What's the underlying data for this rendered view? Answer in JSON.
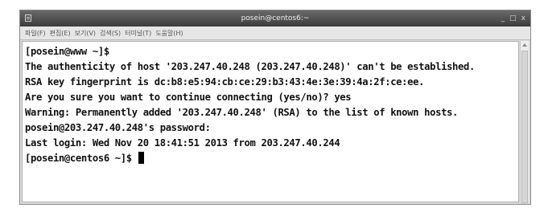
{
  "window": {
    "title": "posein@centos6:~",
    "controls": {
      "minimize": "_",
      "maximize": "□",
      "close": "x"
    }
  },
  "menubar": {
    "items": [
      "파일(F)",
      "편집(E)",
      "보기(V)",
      "검색(S)",
      "터미널(T)",
      "도움말(H)"
    ]
  },
  "terminal": {
    "lines": [
      "[posein@www ~]$",
      "The authenticity of host '203.247.40.248 (203.247.40.248)' can't be established.",
      "RSA key fingerprint is dc:b8:e5:94:cb:ce:29:b3:43:4e:3e:39:4a:2f:ce:ee.",
      "Are you sure you want to continue connecting (yes/no)? yes",
      "Warning: Permanently added '203.247.40.248' (RSA) to the list of known hosts.",
      "posein@203.247.40.248's password:",
      "Last login: Wed Nov 20 18:41:51 2013 from 203.247.40.244",
      "[posein@centos6 ~]$ "
    ]
  },
  "icons": {
    "app": "terminal-icon",
    "cursor": "block-cursor"
  }
}
